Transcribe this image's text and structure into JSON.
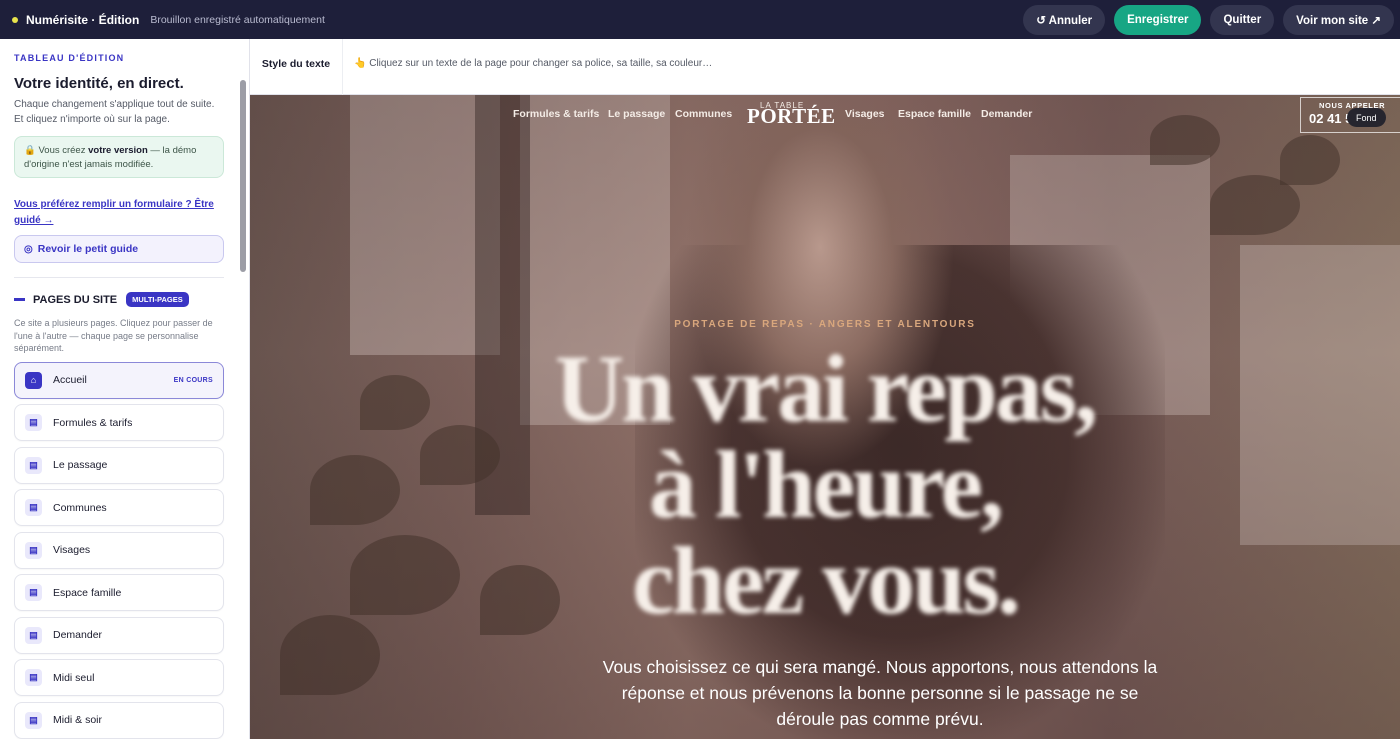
{
  "topbar": {
    "app_title": "Numérisite · Édition",
    "autosave": "Brouillon enregistré automatiquement",
    "undo_label": "↺ Annuler",
    "save_label": "Enregistrer",
    "quit_label": "Quitter",
    "view_label": "Voir mon site ↗"
  },
  "sidebar": {
    "eyebrow": "TABLEAU D'ÉDITION",
    "title": "Votre identité, en direct.",
    "description": "Chaque changement s'applique tout de suite. Et cliquez n'importe où sur la page.",
    "note_prefix": "🔒 Vous créez ",
    "note_bold": "votre version",
    "note_suffix": " — la démo d'origine n'est jamais modifiée.",
    "form_link": "Vous préférez remplir un formulaire ? Être guidé →",
    "guide_button": "Revoir le petit guide",
    "pages_title": "PAGES DU SITE",
    "pages_badge": "MULTI-PAGES",
    "pages_description": "Ce site a plusieurs pages. Cliquez pour passer de l'une à l'autre — chaque page se personnalise séparément.",
    "pages": [
      {
        "label": "Accueil",
        "badge": "EN COURS",
        "active": true
      },
      {
        "label": "Formules & tarifs",
        "badge": ""
      },
      {
        "label": "Le passage",
        "badge": ""
      },
      {
        "label": "Communes",
        "badge": ""
      },
      {
        "label": "Visages",
        "badge": ""
      },
      {
        "label": "Espace famille",
        "badge": ""
      },
      {
        "label": "Demander",
        "badge": ""
      },
      {
        "label": "Midi seul",
        "badge": ""
      },
      {
        "label": "Midi & soir",
        "badge": ""
      }
    ]
  },
  "toolbar": {
    "tab_label": "Style du texte",
    "hint": "👆 Cliquez sur un texte de la page pour changer sa police, sa taille, sa couleur…"
  },
  "site": {
    "nav": [
      "Formules & tarifs",
      "Le passage",
      "Communes",
      "Visages",
      "Espace famille",
      "Demander"
    ],
    "logo_small": "LA TABLE",
    "logo_big": "PORTÉE",
    "call_label": "NOUS APPELER",
    "call_number": "02 41 5",
    "fond_label": "Fond",
    "kicker": "PORTAGE DE REPAS · ANGERS ET ALENTOURS",
    "headline_1": "Un vrai repas,",
    "headline_2": "à l'heure,",
    "headline_3": "chez vous.",
    "lede": "Vous choisissez ce qui sera mangé. Nous apportons, nous attendons la réponse et nous prévenons la bonne personne si le passage ne se déroule pas comme prévu."
  },
  "colors": {
    "topbar": "#1e1f3a",
    "accent": "#3a35c4",
    "save": "#17a684",
    "kicker": "#d9a77d"
  }
}
